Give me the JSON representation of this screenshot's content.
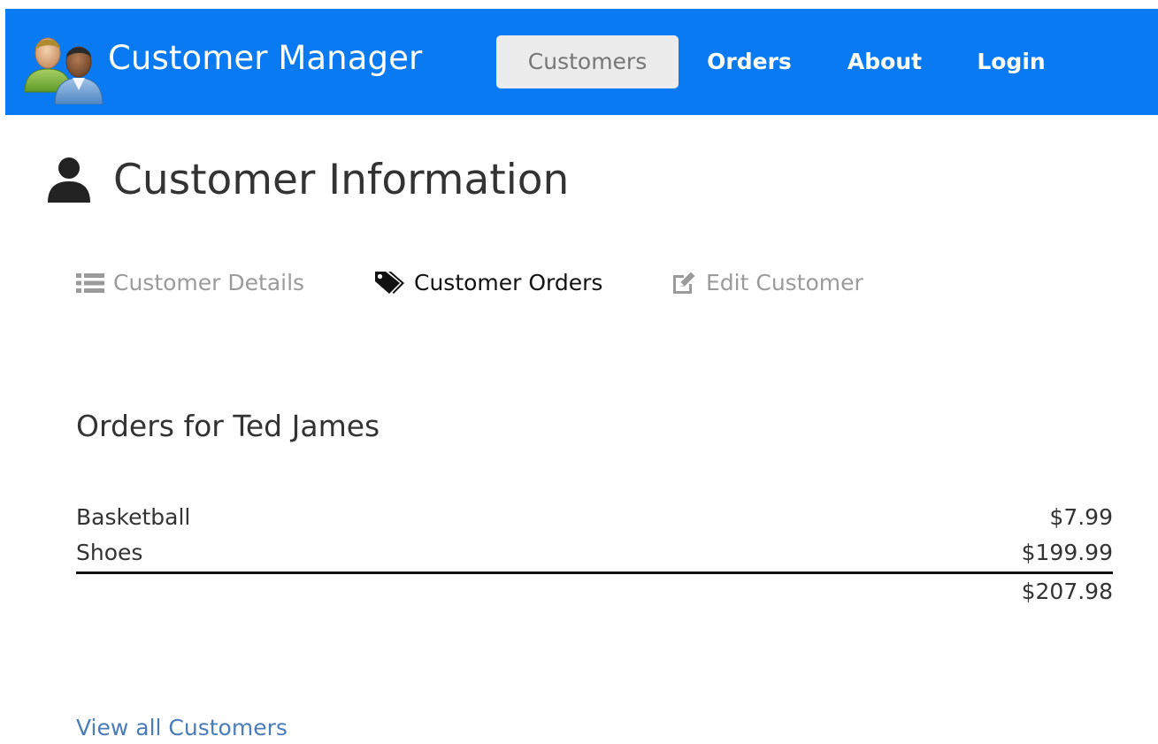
{
  "navbar": {
    "brand_title": "Customer Manager",
    "brand_icon": "customers-logo-icon",
    "items": [
      {
        "label": "Customers",
        "active": true
      },
      {
        "label": "Orders",
        "active": false
      },
      {
        "label": "About",
        "active": false
      },
      {
        "label": "Login",
        "active": false
      }
    ],
    "background_color": "#0a7af2"
  },
  "page": {
    "title": "Customer Information",
    "title_icon": "user-icon"
  },
  "tabs": [
    {
      "label": "Customer Details",
      "icon": "list-icon",
      "active": false
    },
    {
      "label": "Customer Orders",
      "icon": "tags-icon",
      "active": true
    },
    {
      "label": "Edit Customer",
      "icon": "edit-icon",
      "active": false
    }
  ],
  "orders": {
    "heading": "Orders for Ted James",
    "rows": [
      {
        "product": "Basketball",
        "price": "$7.99"
      },
      {
        "product": "Shoes",
        "price": "$199.99"
      }
    ],
    "total": "$207.98"
  },
  "footer": {
    "view_all_label": "View all Customers"
  }
}
